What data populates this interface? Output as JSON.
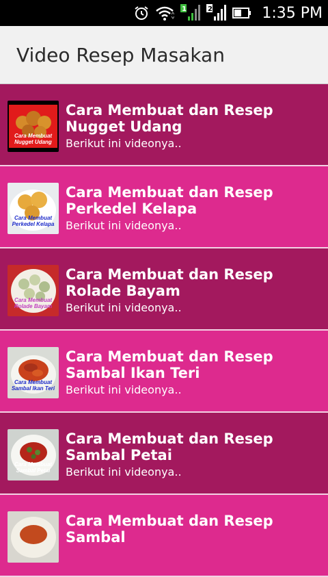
{
  "status_bar": {
    "time": "1:35 PM",
    "icons": [
      "alarm-icon",
      "wifi-icon",
      "signal-sim1-icon",
      "signal-sim2-icon",
      "battery-icon"
    ]
  },
  "app_bar": {
    "title": "Video Resep Masakan"
  },
  "items": [
    {
      "title": "Cara Membuat dan Resep Nugget Udang",
      "subtitle": "Berikut ini videonya..",
      "thumb_caption": "Cara Membuat Nugget Udang",
      "bg": "#a3195e"
    },
    {
      "title": "Cara Membuat dan Resep Perkedel Kelapa",
      "subtitle": "Berikut ini videonya..",
      "thumb_caption": "Cara Membuat Perkedel Kelapa",
      "bg": "#dd2a8e"
    },
    {
      "title": "Cara Membuat dan Resep Rolade Bayam",
      "subtitle": "Berikut ini videonya..",
      "thumb_caption": "Cara Membuat Rolade Bayam",
      "bg": "#a3195e"
    },
    {
      "title": "Cara Membuat dan Resep Sambal Ikan Teri",
      "subtitle": "Berikut ini videonya..",
      "thumb_caption": "Cara Membuat Sambal Ikan Teri",
      "bg": "#dd2a8e"
    },
    {
      "title": "Cara Membuat dan Resep Sambal Petai",
      "subtitle": "Berikut ini videonya..",
      "thumb_caption": "Cara Membuat Sambal Petai",
      "bg": "#a3195e"
    },
    {
      "title": "Cara Membuat dan Resep Sambal",
      "subtitle": "",
      "thumb_caption": "",
      "bg": "#dd2a8e"
    }
  ]
}
